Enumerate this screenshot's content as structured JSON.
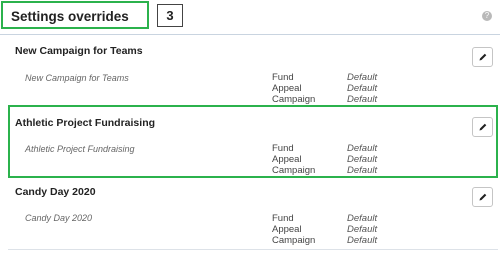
{
  "header": {
    "title": "Settings overrides",
    "step": "3",
    "help": "?"
  },
  "override_labels": [
    "Fund",
    "Appeal",
    "Campaign"
  ],
  "campaigns": [
    {
      "name": "New Campaign for Teams",
      "subtitle": "New Campaign for Teams",
      "values": [
        "Default",
        "Default",
        "Default"
      ]
    },
    {
      "name": "Athletic Project Fundraising",
      "subtitle": "Athletic Project Fundraising",
      "values": [
        "Default",
        "Default",
        "Default"
      ]
    },
    {
      "name": "Candy Day 2020",
      "subtitle": "Candy Day 2020",
      "values": [
        "Default",
        "Default",
        "Default"
      ]
    }
  ]
}
